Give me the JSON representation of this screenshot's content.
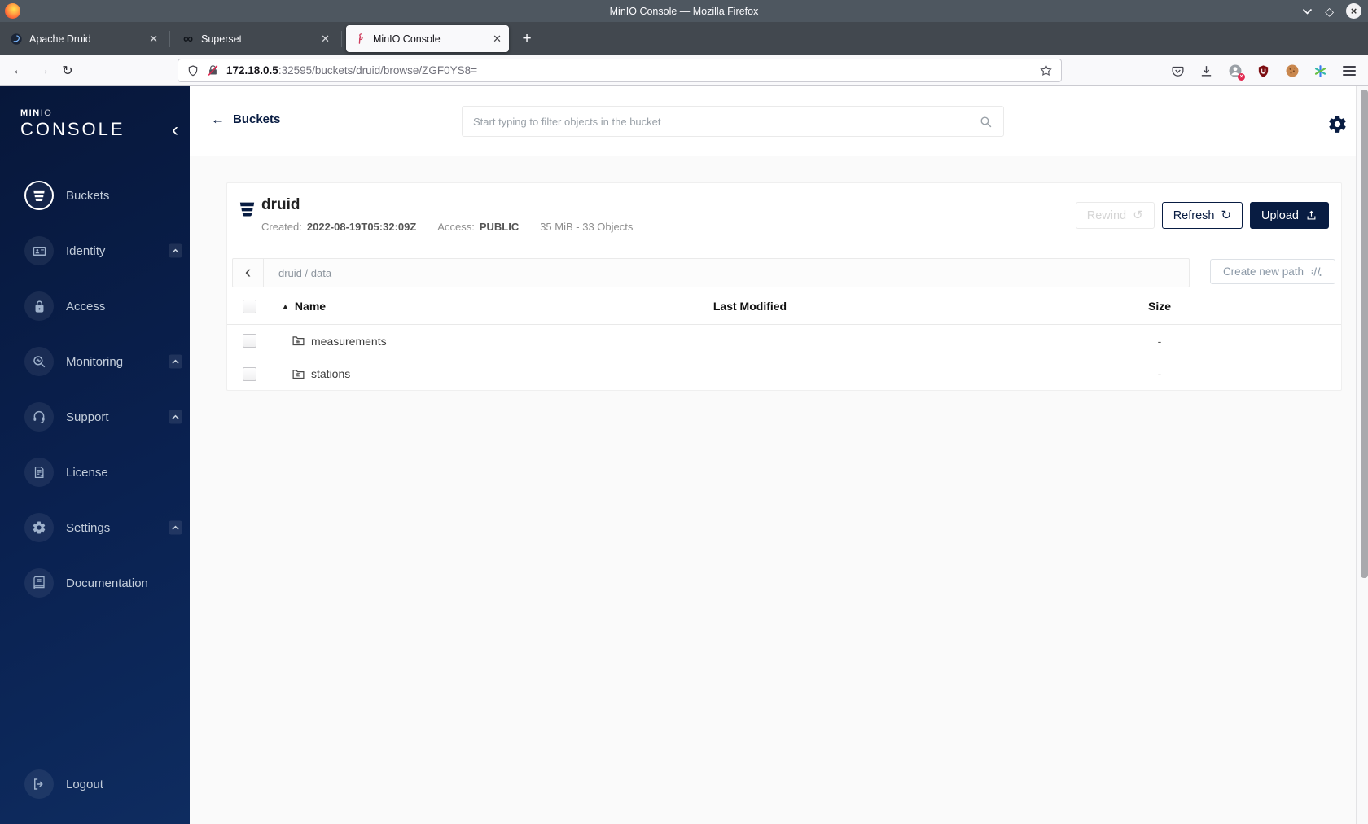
{
  "theme": {
    "navy": "#081C42",
    "sidebar_top": "#07173a",
    "sidebar_bottom": "#0e2c60",
    "flamingo_red": "#cf3f5f",
    "insecure_red": "#e22850"
  },
  "browser": {
    "window_title": "MinIO Console — Mozilla Firefox",
    "tabs": [
      {
        "label": "Apache Druid",
        "icon": "druid-logo"
      },
      {
        "label": "Superset",
        "icon": "superset-logo"
      },
      {
        "label": "MinIO Console",
        "icon": "minio-flamingo-logo"
      }
    ],
    "url_host": "172.18.0.5",
    "url_rest": ":32595/buckets/druid/browse/ZGF0YS8="
  },
  "sidebar": {
    "logo_min": "MIN",
    "logo_io": "IO",
    "logo_console": "CONSOLE",
    "items": [
      {
        "label": "Buckets",
        "icon": "bucket-icon",
        "active": true
      },
      {
        "label": "Identity",
        "icon": "id-card-icon",
        "caret": true
      },
      {
        "label": "Access",
        "icon": "lock-icon"
      },
      {
        "label": "Monitoring",
        "icon": "monitor-search-icon",
        "caret": true
      },
      {
        "label": "Support",
        "icon": "headset-icon",
        "caret": true
      },
      {
        "label": "License",
        "icon": "license-doc-icon"
      },
      {
        "label": "Settings",
        "icon": "gear-icon",
        "caret": true
      },
      {
        "label": "Documentation",
        "icon": "book-icon"
      }
    ],
    "logout_label": "Logout"
  },
  "header": {
    "back_label": "Buckets",
    "search_placeholder": "Start typing to filter objects in the bucket"
  },
  "bucket": {
    "name": "druid",
    "created_label": "Created:",
    "created_value": "2022-08-19T05:32:09Z",
    "access_label": "Access:",
    "access_value": "PUBLIC",
    "summary": "35 MiB - 33 Objects",
    "rewind_label": "Rewind",
    "refresh_label": "Refresh",
    "upload_label": "Upload"
  },
  "browse": {
    "breadcrumb": "druid / data",
    "create_path_label": "Create new path"
  },
  "objects": {
    "headers": {
      "name": "Name",
      "modified": "Last Modified",
      "size": "Size"
    },
    "rows": [
      {
        "name": "measurements",
        "size": "-"
      },
      {
        "name": "stations",
        "size": "-"
      }
    ]
  }
}
